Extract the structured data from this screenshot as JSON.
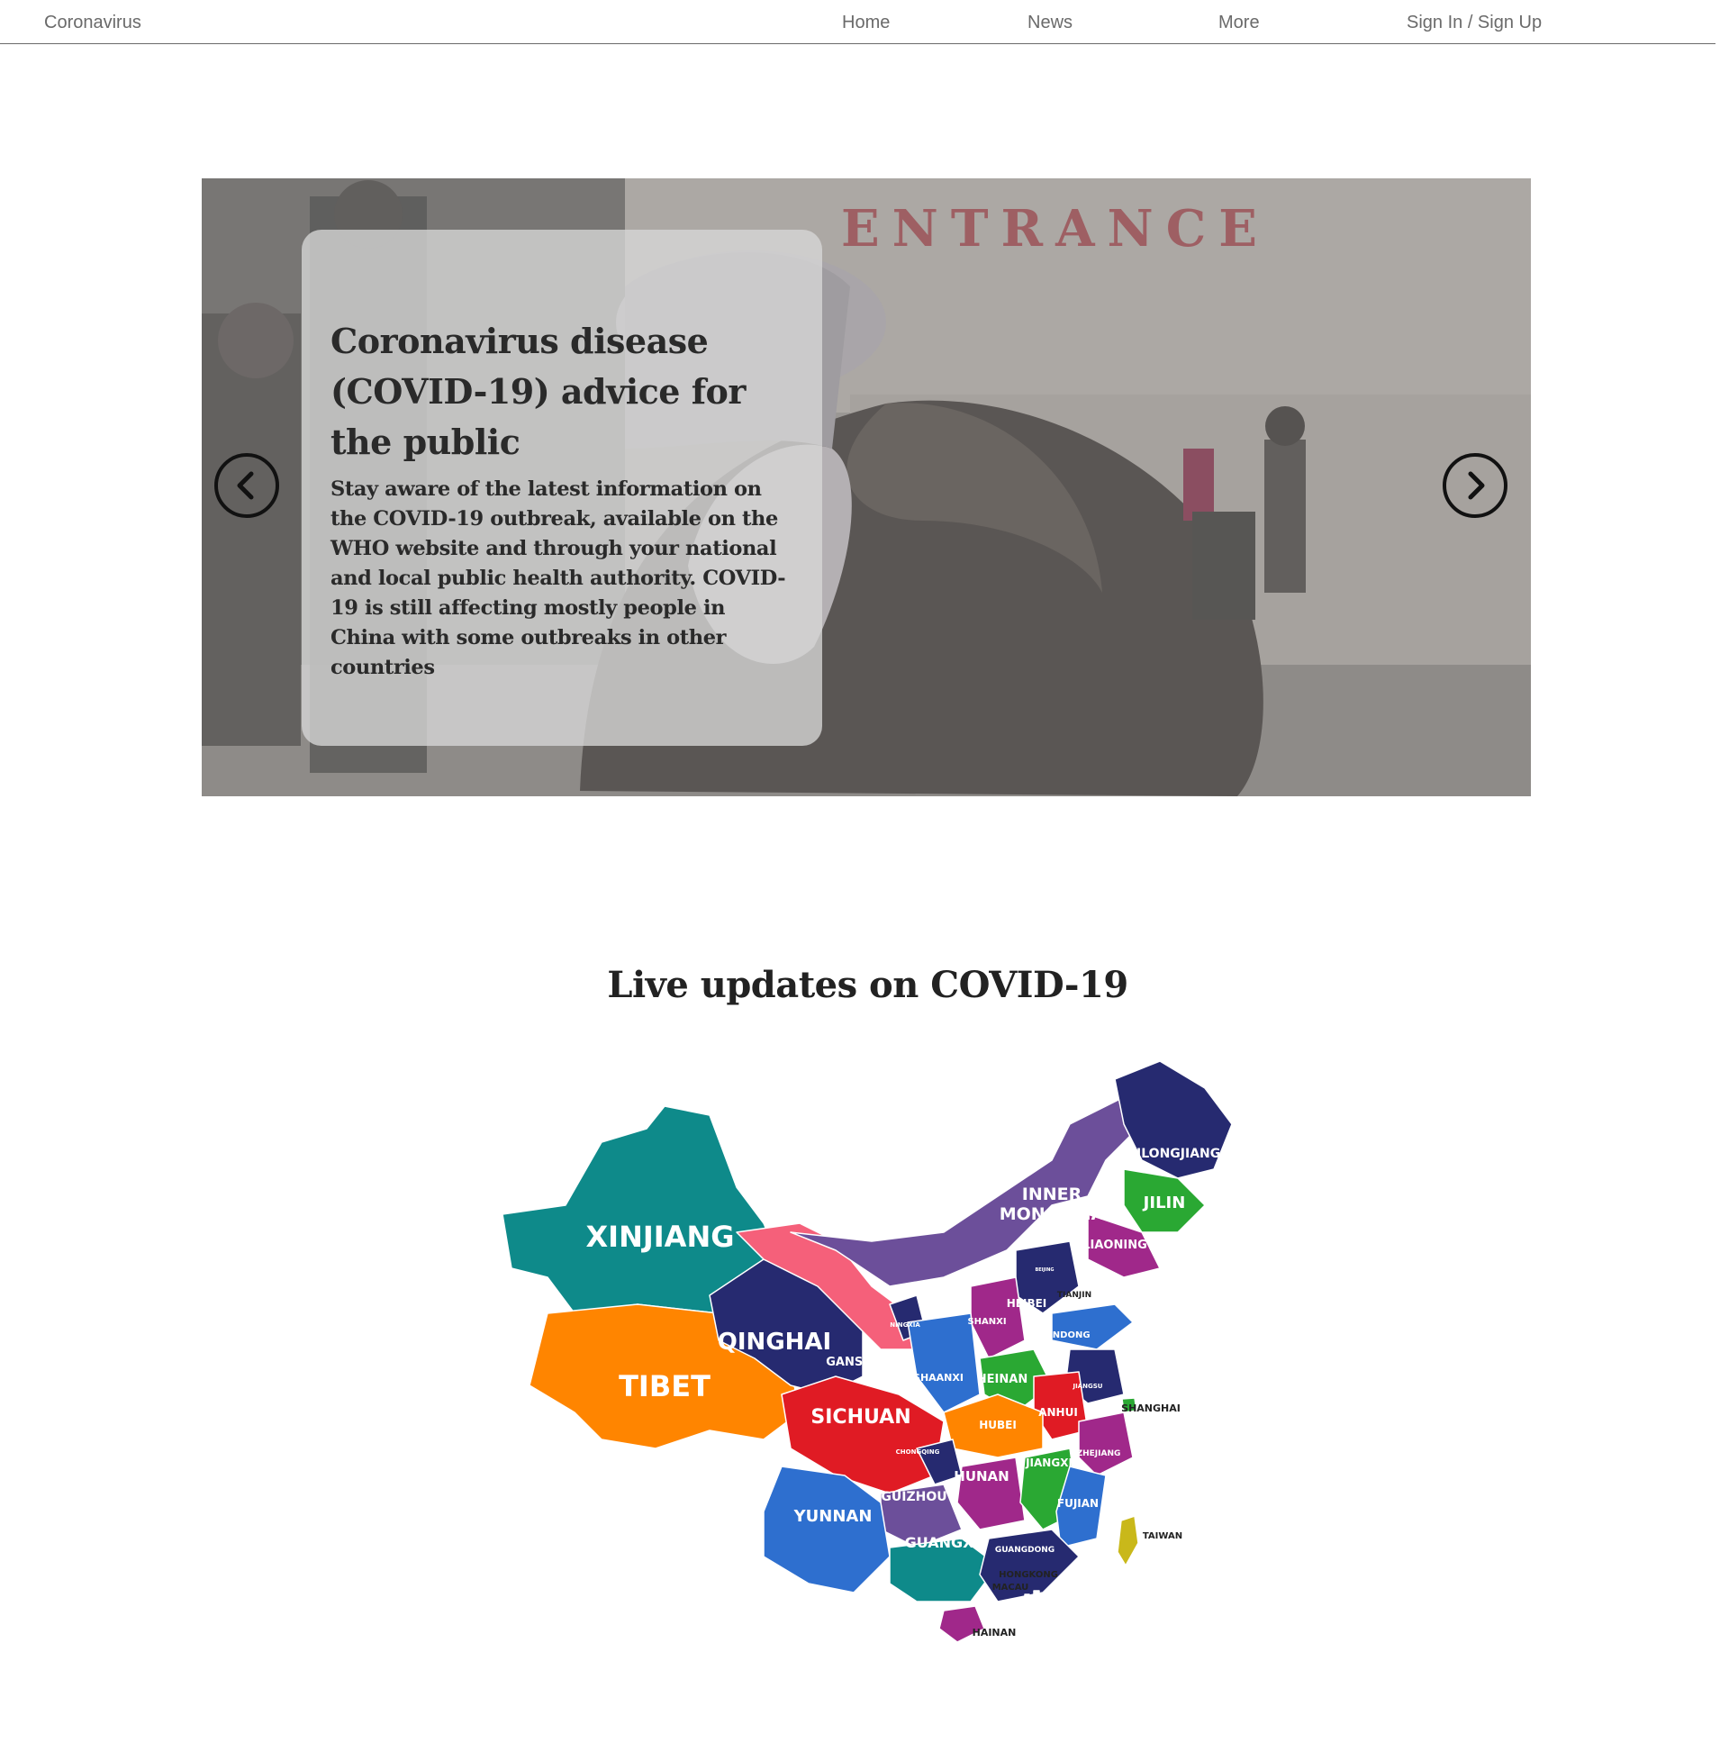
{
  "nav": {
    "brand": "Coronavirus",
    "links": [
      {
        "label": "Home"
      },
      {
        "label": "News"
      },
      {
        "label": "More"
      },
      {
        "label": "Sign In / Sign Up"
      }
    ]
  },
  "hero": {
    "background_text": "ENTRANCE",
    "title": "Coronavirus disease (COVID-19) advice for the public",
    "body": "Stay aware of the latest information on the COVID-19 outbreak, available on the WHO website and through your national and local public health authority. COVID-19 is still affecting mostly people in China with some outbreaks in other countries",
    "prev_icon": "chevron-left-icon",
    "next_icon": "chevron-right-icon"
  },
  "live": {
    "title": "Live updates on COVID-19"
  },
  "map": {
    "regions": [
      {
        "name": "XINJIANG",
        "color": "#0e8a8a"
      },
      {
        "name": "TIBET",
        "color": "#ff8500"
      },
      {
        "name": "QINGHAI",
        "color": "#262a70"
      },
      {
        "name": "GANSU",
        "color": "#f5607a"
      },
      {
        "name": "INNER MONGOLIA",
        "color": "#6c4f9a"
      },
      {
        "name": "HEILONGJIANG",
        "color": "#262a70"
      },
      {
        "name": "JILIN",
        "color": "#2aa833"
      },
      {
        "name": "LIAONING",
        "color": "#a0288a"
      },
      {
        "name": "BEIJING",
        "color": "#e01b24"
      },
      {
        "name": "TIANJIN",
        "color": "#ffffff"
      },
      {
        "name": "HEIBEI",
        "color": "#262a70"
      },
      {
        "name": "SHANDONG",
        "color": "#2e6fcf"
      },
      {
        "name": "SHANXI",
        "color": "#a0288a"
      },
      {
        "name": "NINGXIA",
        "color": "#262a70"
      },
      {
        "name": "SHAANXI",
        "color": "#2e6fcf"
      },
      {
        "name": "HEINAN",
        "color": "#2aa833"
      },
      {
        "name": "JIANGSU",
        "color": "#262a70"
      },
      {
        "name": "SHANGHAI",
        "color": "#2aa833"
      },
      {
        "name": "ANHUI",
        "color": "#e01b24"
      },
      {
        "name": "SICHUAN",
        "color": "#e01b24"
      },
      {
        "name": "HUBEI",
        "color": "#ff8500"
      },
      {
        "name": "CHONGQING",
        "color": "#262a70"
      },
      {
        "name": "ZHEJIANG",
        "color": "#a0288a"
      },
      {
        "name": "HUNAN",
        "color": "#a0288a"
      },
      {
        "name": "JIANGXI",
        "color": "#2aa833"
      },
      {
        "name": "GUIZHOU",
        "color": "#6c4f9a"
      },
      {
        "name": "FUJIAN",
        "color": "#2e6fcf"
      },
      {
        "name": "YUNNAN",
        "color": "#2e6fcf"
      },
      {
        "name": "GUANGXI",
        "color": "#0e8a8a"
      },
      {
        "name": "GUANGDONG",
        "color": "#262a70"
      },
      {
        "name": "TAIWAN",
        "color": "#c9b81a"
      },
      {
        "name": "HONGKONG",
        "color": "#ffffff"
      },
      {
        "name": "MACAU",
        "color": "#ffffff"
      },
      {
        "name": "HAINAN",
        "color": "#a0288a"
      }
    ]
  }
}
